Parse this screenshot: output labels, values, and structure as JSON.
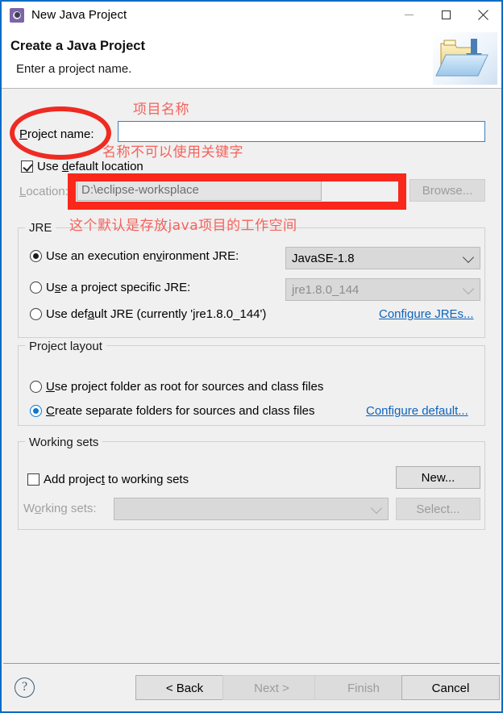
{
  "window": {
    "title": "New Java Project",
    "icon": "eclipse-icon",
    "controls": {
      "minimize": "minimize-icon",
      "maximize": "maximize-icon",
      "close": "close-icon"
    }
  },
  "header": {
    "title": "Create a Java Project",
    "subtitle": "Enter a project name.",
    "icon": "java-project-folder-icon"
  },
  "form": {
    "project_name": {
      "label": "Project name:",
      "value": "",
      "placeholder": ""
    },
    "use_default_location": {
      "label": "Use default location",
      "checked": true
    },
    "location": {
      "label": "Location:",
      "value": "D:\\eclipse-worksplace",
      "browse_label": "Browse...",
      "enabled": false
    }
  },
  "jre": {
    "group_title": "JRE",
    "options": [
      {
        "label": "Use an execution environment JRE:",
        "selected": true
      },
      {
        "label": "Use a project specific JRE:",
        "selected": false
      },
      {
        "label": "Use default JRE (currently 'jre1.8.0_144')",
        "selected": false
      }
    ],
    "execution_environment_value": "JavaSE-1.8",
    "project_specific_value": "jre1.8.0_144",
    "configure_link": "Configure JREs..."
  },
  "project_layout": {
    "group_title": "Project layout",
    "options": [
      {
        "label": "Use project folder as root for sources and class files",
        "selected": false
      },
      {
        "label": "Create separate folders for sources and class files",
        "selected": true
      }
    ],
    "configure_link": "Configure default..."
  },
  "working_sets": {
    "group_title": "Working sets",
    "add_checkbox_label": "Add project to working sets",
    "add_checked": false,
    "new_button": "New...",
    "combo_label": "Working sets:",
    "combo_value": "",
    "select_button": "Select..."
  },
  "footer": {
    "help": "?",
    "back": "< Back",
    "next": "Next >",
    "finish": "Finish",
    "cancel": "Cancel"
  },
  "annotations": {
    "project_name_note": "项目名称",
    "keyword_note": "名称不可以使用关键字",
    "workspace_note": "这个默认是存放java项目的工作空间",
    "highlight_color": "#f9281b",
    "text_color": "#f4625c"
  }
}
